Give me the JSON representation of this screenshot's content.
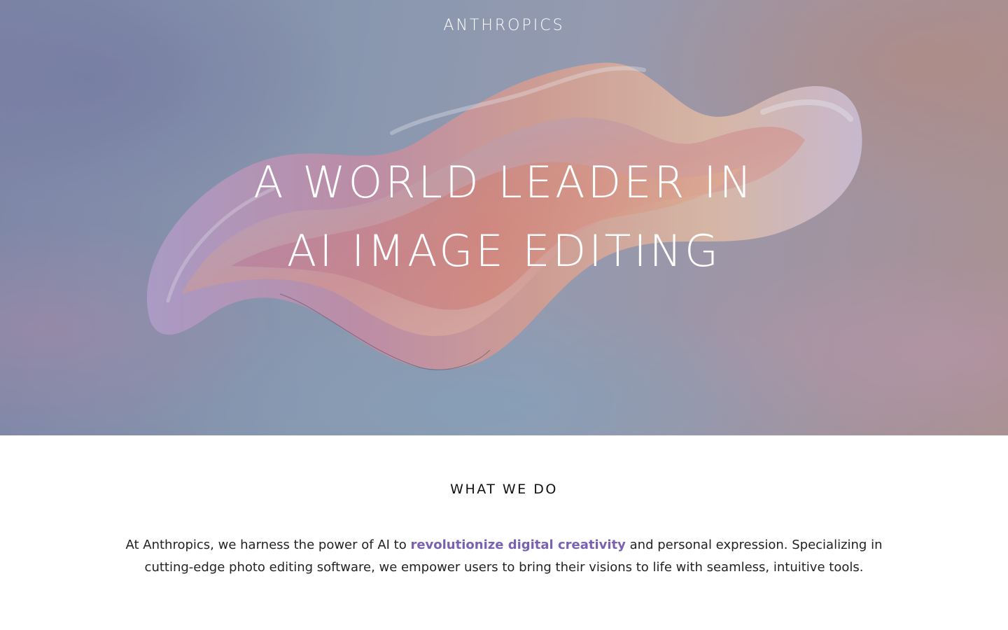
{
  "header": {
    "brand": "ANTHROPICS"
  },
  "hero": {
    "headline_line1": "A WORLD LEADER IN",
    "headline_line2": "AI IMAGE EDITING"
  },
  "what_we_do": {
    "title": "WHAT WE DO",
    "body_before": "At Anthropics, we harness the power of AI to ",
    "body_highlight": "revolutionize digital creativity",
    "body_after": " and personal expression. Specializing in cutting-edge photo editing software, we empower users to bring their visions to life with seamless, intuitive tools."
  },
  "colors": {
    "highlight": "#7a62b0",
    "text": "#222222"
  }
}
